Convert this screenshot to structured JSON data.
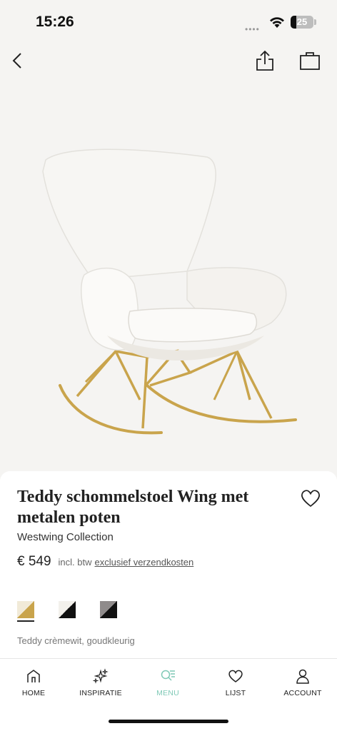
{
  "status_bar": {
    "time": "15:26",
    "battery_level": "25",
    "battery_fraction": 0.25
  },
  "nav": {
    "back_icon": "chevron-left-icon",
    "share_icon": "share-icon",
    "bag_icon": "shopping-bag-icon"
  },
  "product": {
    "title": "Teddy schommelstoel Wing met metalen poten",
    "brand": "Westwing Collection",
    "price": "€ 549",
    "vat_note": "incl. btw",
    "shipping_link": "exclusief verzendkosten",
    "selected_variant": "Teddy crèmewit, goudkleurig",
    "swatches": [
      {
        "name": "cream-gold",
        "colors": [
          "#f1ead8",
          "#c9a44c"
        ],
        "selected": true
      },
      {
        "name": "cream-black",
        "colors": [
          "#f3f1ec",
          "#111111"
        ],
        "selected": false
      },
      {
        "name": "grey-black",
        "colors": [
          "#8f8b8b",
          "#111111"
        ],
        "selected": false
      }
    ]
  },
  "tabs": [
    {
      "label": "HOME",
      "icon": "home-icon",
      "active": false
    },
    {
      "label": "INSPIRATIE",
      "icon": "sparkles-icon",
      "active": false
    },
    {
      "label": "MENU",
      "icon": "search-menu-icon",
      "active": true
    },
    {
      "label": "LIJST",
      "icon": "heart-icon",
      "active": false
    },
    {
      "label": "ACCOUNT",
      "icon": "user-icon",
      "active": false
    }
  ],
  "colors": {
    "accent": "#7fc9b6",
    "background": "#f5f4f2",
    "gold": "#c9a44c"
  }
}
